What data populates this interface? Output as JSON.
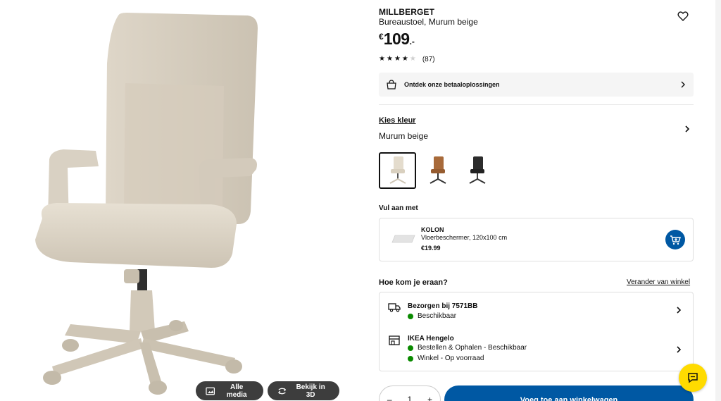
{
  "product": {
    "name": "MILLBERGET",
    "subtitle": "Bureaustoel, Murum beige",
    "price_currency": "€",
    "price_int": "109",
    "price_dec": ".-",
    "rating": 4,
    "rating_max": 5,
    "review_count": "(87)"
  },
  "media": {
    "all_media_label": "Alle media",
    "view3d_label": "Bekijk in 3D"
  },
  "payment": {
    "label": "Ontdek onze betaaloplossingen"
  },
  "color": {
    "link_label": "Kies kleur",
    "selected_name": "Murum beige",
    "swatches": [
      "beige",
      "brown",
      "black"
    ]
  },
  "addon": {
    "heading": "Vul aan met",
    "name": "KOLON",
    "description": "Vloerbeschermer, 120x100 cm",
    "price": "€19.99"
  },
  "delivery": {
    "heading": "Hoe kom je eraan?",
    "change_store_label": "Verander van winkel",
    "ship_title": "Bezorgen bij 7571BB",
    "ship_status": "Beschikbaar",
    "store_title": "IKEA Hengelo",
    "store_line1": "Bestellen & Ophalen - Beschikbaar",
    "store_line2": "Winkel - Op voorraad"
  },
  "purchase": {
    "quantity": "1",
    "minus": "–",
    "plus": "+",
    "add_label": "Voeg toe aan winkelwagen"
  },
  "colors": {
    "accent_blue": "#0058a3",
    "status_green": "#0a8a00",
    "chat_yellow": "#ffdb00"
  }
}
